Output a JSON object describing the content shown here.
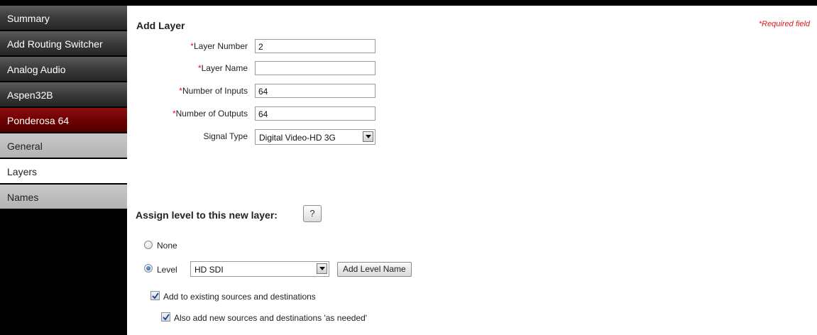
{
  "sidebar": {
    "items": [
      {
        "label": "Summary"
      },
      {
        "label": "Add Routing Switcher"
      },
      {
        "label": "Analog Audio"
      },
      {
        "label": "Aspen32B"
      },
      {
        "label": "Ponderosa 64"
      },
      {
        "label": "General"
      },
      {
        "label": "Layers"
      },
      {
        "label": "Names"
      }
    ],
    "active": "Layers"
  },
  "main": {
    "title": "Add Layer",
    "required_note": "*Required field",
    "fields": {
      "layer_number": {
        "label": "Layer Number",
        "value": "2"
      },
      "layer_name": {
        "label": "Layer Name",
        "value": ""
      },
      "num_inputs": {
        "label": "Number of Inputs",
        "value": "64"
      },
      "num_outputs": {
        "label": "Number of Outputs",
        "value": "64"
      },
      "signal_type": {
        "label": "Signal Type",
        "value": "Digital Video-HD 3G"
      }
    },
    "required_marker": "*",
    "assign": {
      "title": "Assign level to this new layer:",
      "help_label": "?",
      "none_label": "None",
      "level_label": "Level",
      "level_value": "HD SDI",
      "add_level_name_label": "Add Level Name",
      "add_existing_label": "Add to existing sources and destinations",
      "add_as_needed_label": "Also add new sources and destinations 'as needed'",
      "selected": "Level"
    }
  },
  "colors": {
    "required": "#e0171e",
    "selected_nav_red": "#6b0000",
    "sidebar_dark": "#3a3a3a",
    "sidebar_grey": "#b3b3b3"
  }
}
